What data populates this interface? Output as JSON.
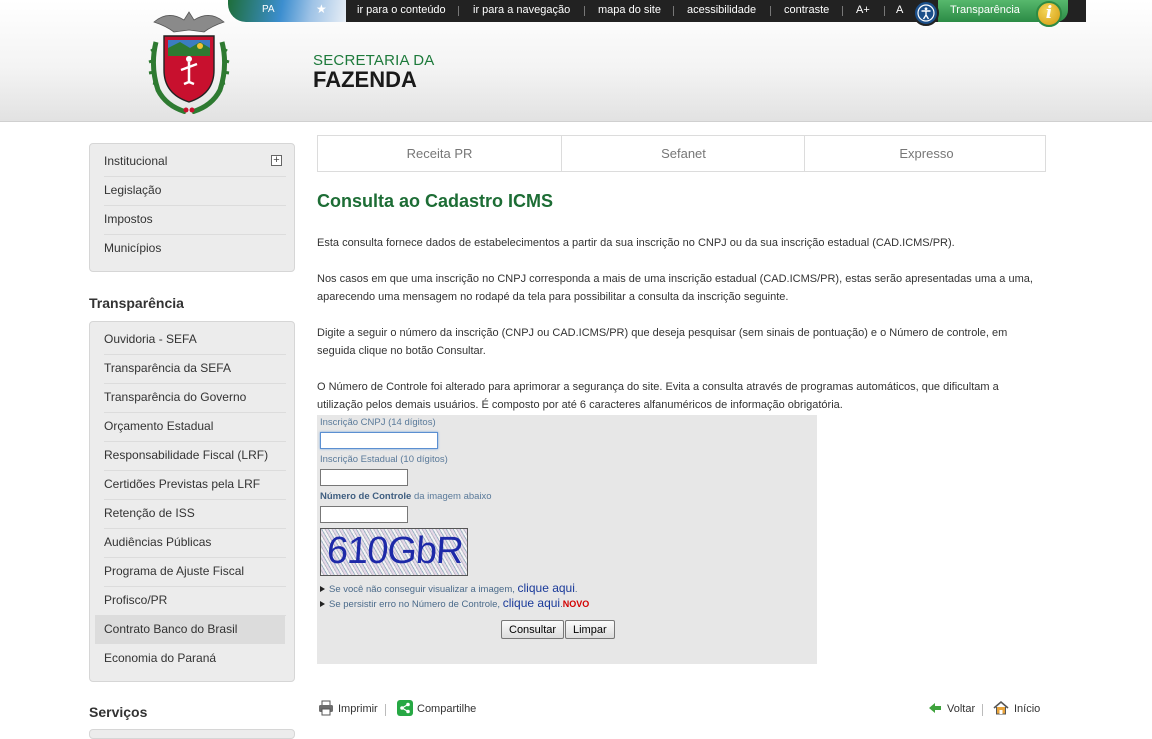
{
  "topbar": {
    "flag_text": "PA",
    "links": [
      "ir para o conteúdo",
      "ir para a navegação",
      "mapa do site",
      "acessibilidade",
      "contraste",
      "A+",
      "A"
    ],
    "transparencia": "Transparência",
    "info_glyph": "i"
  },
  "brand": {
    "line1": "SECRETARIA DA",
    "line2": "FAZENDA"
  },
  "sidebar": {
    "menu1": [
      "Institucional",
      "Legislação",
      "Impostos",
      "Municípios"
    ],
    "transparencia_heading": "Transparência",
    "menu2": [
      "Ouvidoria - SEFA",
      "Transparência da SEFA",
      "Transparência do Governo",
      "Orçamento Estadual",
      "Responsabilidade Fiscal (LRF)",
      "Certidões Previstas pela LRF",
      "Retenção de ISS",
      "Audiências Públicas",
      "Programa de Ajuste Fiscal",
      "Profisco/PR",
      "Contrato Banco do Brasil",
      "Economia do Paraná"
    ],
    "active_item": "Contrato Banco do Brasil",
    "servicos_heading": "Serviços"
  },
  "tabs": [
    "Receita PR",
    "Sefanet",
    "Expresso"
  ],
  "main": {
    "title": "Consulta ao Cadastro ICMS",
    "p1": "Esta consulta fornece dados de estabelecimentos a partir da sua inscrição no CNPJ ou da sua inscrição estadual (CAD.ICMS/PR).",
    "p2": "Nos casos em que uma inscrição no CNPJ corresponda a mais de uma inscrição estadual (CAD.ICMS/PR), estas serão apresentadas uma a uma, aparecendo uma mensagem no rodapé da tela para possibilitar a consulta da inscrição seguinte.",
    "p3": "Digite a seguir o número da inscrição (CNPJ ou CAD.ICMS/PR) que deseja pesquisar (sem sinais de pontuação) e o Número de controle, em seguida clique no botão Consultar.",
    "p4": "O Número de Controle foi alterado para aprimorar a segurança do site. Evita a consulta através de programas automáticos, que dificultam a utilização pelos demais usuários. É composto por até 6 caracteres alfanuméricos de informação obrigatória."
  },
  "form": {
    "cnpj_label": "Inscrição CNPJ (14 dígitos)",
    "cnpj_value": "",
    "ie_label": "Inscrição Estadual (10 dígitos)",
    "ie_value": "",
    "controle_label_bold": "Número de Controle",
    "controle_label_rest": " da imagem abaixo",
    "controle_value": "",
    "captcha_text": "610GbR",
    "help1_text": "Se você não conseguir visualizar a imagem, ",
    "help1_link": "clique aqui",
    "help1_end": ".",
    "help2_text": "Se persistir erro no Número de Controle, ",
    "help2_link": "clique aqui",
    "help2_end": ".",
    "novo": "NOVO",
    "btn_consultar": "Consultar",
    "btn_limpar": "Limpar"
  },
  "footer": {
    "imprimir": "Imprimir",
    "compartilhe": "Compartilhe",
    "voltar": "Voltar",
    "inicio": "Início"
  },
  "colors": {
    "green": "#1d6d35",
    "link_blue": "#1a3a9a",
    "novo_red": "#d30000"
  }
}
